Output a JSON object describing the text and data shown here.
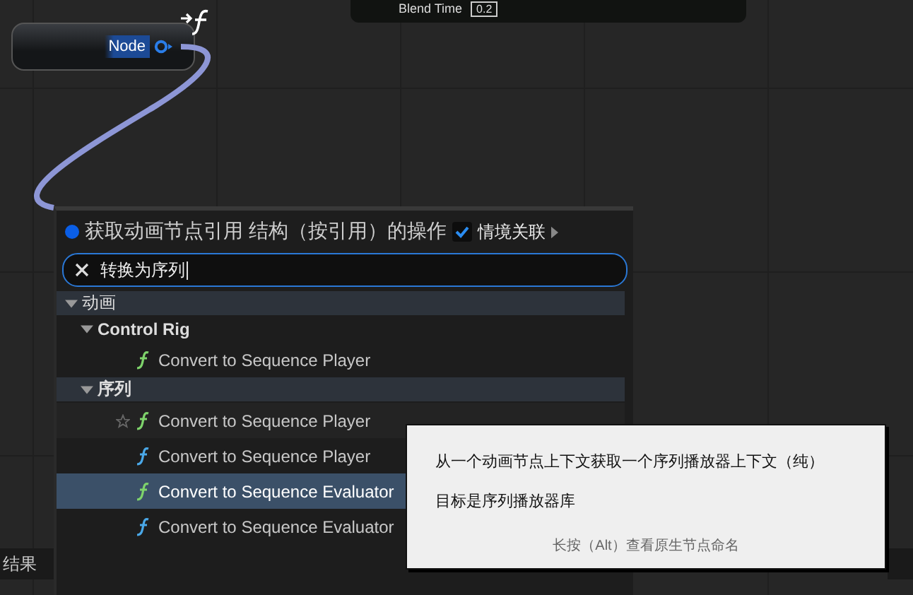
{
  "top_node": {
    "label": "Blend Time",
    "value": "0.2"
  },
  "graph_node": {
    "title": "Node"
  },
  "bottom_tab": {
    "label": "结果"
  },
  "menu": {
    "title": "获取动画节点引用 结构（按引用）的操作",
    "context": {
      "label": "情境关联",
      "checked": true
    },
    "search": {
      "value": "转换为序列"
    },
    "tree": [
      {
        "kind": "category",
        "label": "动画",
        "expanded": true,
        "children": [
          {
            "kind": "category",
            "label": "Control Rig",
            "expanded": true,
            "children": [
              {
                "kind": "action",
                "label": "Convert to Sequence Player",
                "color": "#7ed36b",
                "selected": false,
                "hovered": false
              }
            ]
          },
          {
            "kind": "category",
            "label": "序列",
            "expanded": true,
            "children": [
              {
                "kind": "action",
                "label": "Convert to Sequence Player",
                "color": "#7ed36b",
                "selected": false,
                "hovered": true
              },
              {
                "kind": "action",
                "label": "Convert to Sequence Player",
                "color": "#4aa8e8",
                "selected": false,
                "hovered": false
              },
              {
                "kind": "action",
                "label": "Convert to Sequence Evaluator",
                "color": "#7ed36b",
                "selected": true,
                "hovered": false
              },
              {
                "kind": "action",
                "label": "Convert to Sequence Evaluator",
                "color": "#4aa8e8",
                "selected": false,
                "hovered": false
              }
            ]
          }
        ]
      }
    ]
  },
  "tooltip": {
    "description": "从一个动画节点上下文获取一个序列播放器上下文（纯）",
    "target": "目标是序列播放器库",
    "hint": "长按（Alt）查看原生节点命名"
  }
}
